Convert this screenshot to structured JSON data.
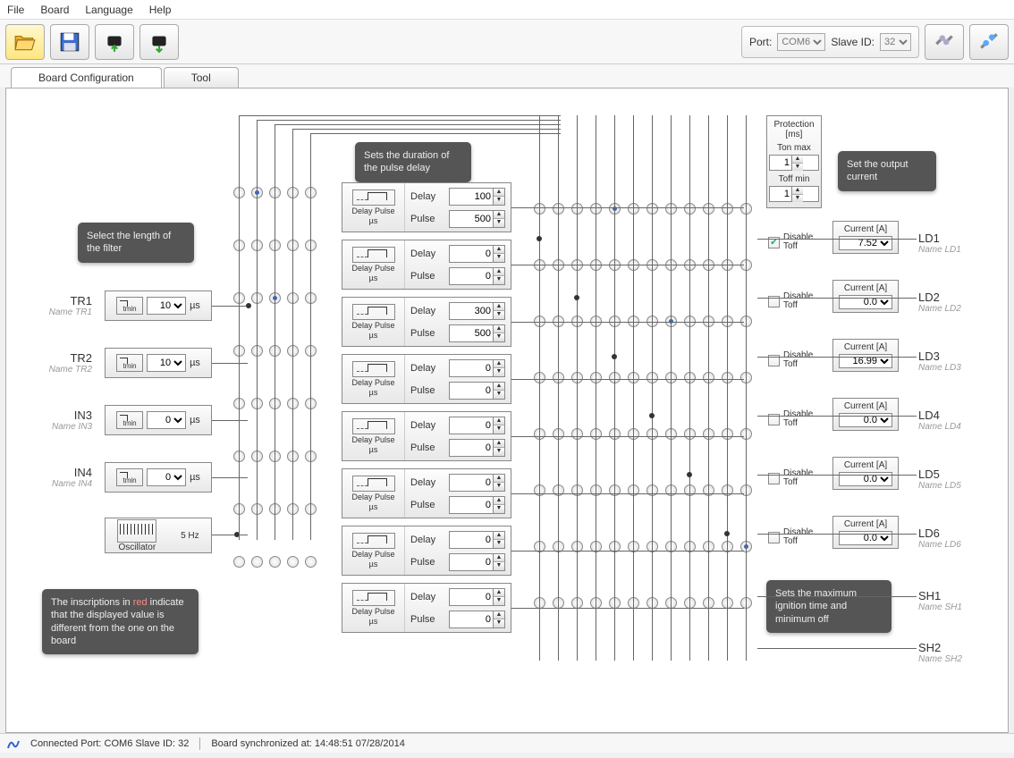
{
  "menu": {
    "file": "File",
    "board": "Board",
    "language": "Language",
    "help": "Help"
  },
  "toolbar": {
    "port_label": "Port:",
    "port": "COM6",
    "slave_label": "Slave ID:",
    "slave": "32"
  },
  "tabs": {
    "config": "Board Configuration",
    "tool": "Tool"
  },
  "tooltips": {
    "filter": "Select the length of the filter",
    "pulse": "Sets the duration of the pulse delay",
    "output": "Set the output current",
    "ignition": "Sets the maximum ignition time and minimum off",
    "red_pre": "The inscriptions in ",
    "red_word": "red",
    "red_post": " indicate that the displayed value is different from the one on the board"
  },
  "inputs": [
    {
      "label": "TR1",
      "sub": "Name TR1",
      "val": "10"
    },
    {
      "label": "TR2",
      "sub": "Name TR2",
      "val": "10"
    },
    {
      "label": "IN3",
      "sub": "Name IN3",
      "val": "0"
    },
    {
      "label": "IN4",
      "sub": "Name IN4",
      "val": "0"
    }
  ],
  "osc": {
    "label": "Oscillator",
    "freq": "5 Hz"
  },
  "dp_label": {
    "icon": "Delay  Pulse",
    "unit": "µs",
    "delay": "Delay",
    "pulse": "Pulse"
  },
  "dp": [
    {
      "delay": "100",
      "pulse": "500"
    },
    {
      "delay": "0",
      "pulse": "0"
    },
    {
      "delay": "300",
      "pulse": "500"
    },
    {
      "delay": "0",
      "pulse": "0"
    },
    {
      "delay": "0",
      "pulse": "0"
    },
    {
      "delay": "0",
      "pulse": "0"
    },
    {
      "delay": "0",
      "pulse": "0"
    },
    {
      "delay": "0",
      "pulse": "0"
    }
  ],
  "protection": {
    "title": "Protection [ms]",
    "ton": "Ton max",
    "ton_val": "1",
    "toff": "Toff min",
    "toff_val": "1"
  },
  "disable_toff": "Disable Toff",
  "disable_checked": [
    true,
    false,
    false,
    false,
    false,
    false
  ],
  "current_label": "Current [A]",
  "currents": [
    "7.52",
    "0.0",
    "16.99",
    "0.0",
    "0.0",
    "0.0"
  ],
  "outputs": [
    {
      "label": "LD1",
      "sub": "Name LD1"
    },
    {
      "label": "LD2",
      "sub": "Name LD2"
    },
    {
      "label": "LD3",
      "sub": "Name LD3"
    },
    {
      "label": "LD4",
      "sub": "Name LD4"
    },
    {
      "label": "LD5",
      "sub": "Name LD5"
    },
    {
      "label": "LD6",
      "sub": "Name LD6"
    },
    {
      "label": "SH1",
      "sub": "Name SH1"
    },
    {
      "label": "SH2",
      "sub": "Name SH2"
    }
  ],
  "tmin": "tmin",
  "us": "µs",
  "status": {
    "conn": "Connected Port: COM6 Slave ID: 32",
    "sync": "Board synchronized at: 14:48:51 07/28/2014"
  }
}
